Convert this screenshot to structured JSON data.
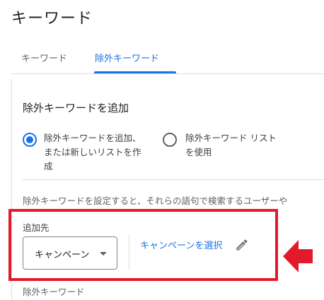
{
  "page": {
    "title": "キーワード"
  },
  "tabs": [
    {
      "label": "キーワード",
      "active": false
    },
    {
      "label": "除外キーワード",
      "active": true
    }
  ],
  "section": {
    "title": "除外キーワードを追加",
    "options": [
      {
        "label": "除外キーワードを追加、\nまたは新しいリストを作\n成",
        "selected": true
      },
      {
        "label": "除外キーワード リスト\nを使用",
        "selected": false
      }
    ],
    "info": "除外キーワードを設定すると、それらの語句で検索するユーザーや"
  },
  "destination": {
    "label": "追加先",
    "dropdown_value": "キャンペーン",
    "select_link": "キャンペーンを選択"
  },
  "bottom": {
    "label": "除外キーワード"
  },
  "colors": {
    "accent": "#1a73e8",
    "highlight": "#e21a2c"
  },
  "icons": {
    "edit": "pencil-icon",
    "dropdown": "triangle-down-icon",
    "annotation": "arrow-left-icon"
  }
}
